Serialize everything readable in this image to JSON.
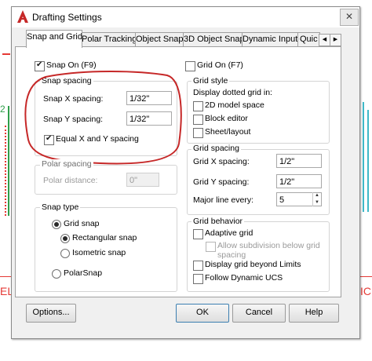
{
  "window": {
    "title": "Drafting Settings",
    "close_symbol": "✕",
    "logo_icon": "autocad-logo-icon"
  },
  "tabs": [
    {
      "label": "Snap and Grid"
    },
    {
      "label": "Polar Tracking"
    },
    {
      "label": "Object Snap"
    },
    {
      "label": "3D Object Snap"
    },
    {
      "label": "Dynamic Input"
    },
    {
      "label": "Quic"
    }
  ],
  "snap_on": {
    "label": "Snap On (F9)",
    "checked": true
  },
  "grid_on": {
    "label": "Grid On (F7)",
    "checked": false
  },
  "snap_spacing": {
    "title": "Snap spacing",
    "x_label": "Snap X spacing:",
    "x_value": "1/32\"",
    "y_label": "Snap Y spacing:",
    "y_value": "1/32\"",
    "equal_label": "Equal X and Y spacing",
    "equal_checked": true
  },
  "polar_spacing": {
    "title": "Polar spacing",
    "distance_label": "Polar distance:",
    "distance_value": "0\""
  },
  "snap_type": {
    "title": "Snap type",
    "grid_snap": "Grid snap",
    "rectangular": "Rectangular snap",
    "isometric": "Isometric snap",
    "polar": "PolarSnap"
  },
  "grid_style": {
    "title": "Grid style",
    "subtitle": "Display dotted grid in:",
    "items": [
      "2D model space",
      "Block editor",
      "Sheet/layout"
    ]
  },
  "grid_spacing": {
    "title": "Grid spacing",
    "x_label": "Grid X spacing:",
    "x_value": "1/2\"",
    "y_label": "Grid Y spacing:",
    "y_value": "1/2\"",
    "major_label": "Major line every:",
    "major_value": "5"
  },
  "grid_behavior": {
    "title": "Grid behavior",
    "adaptive": "Adaptive grid",
    "subdivision_line1": "Allow subdivision below grid",
    "subdivision_line2": "spacing",
    "beyond_limits": "Display grid beyond Limits",
    "follow_ucs": "Follow Dynamic UCS"
  },
  "buttons": {
    "options": "Options...",
    "ok": "OK",
    "cancel": "Cancel",
    "help": "Help"
  },
  "background_labels": {
    "left": "EL",
    "right": "IC",
    "left_number": "2"
  },
  "colors": {
    "annotation_circle": "#c62828",
    "cad_red": "#e53935",
    "cad_green": "#2e9e4a",
    "cad_cyan": "#3fb8c8"
  }
}
